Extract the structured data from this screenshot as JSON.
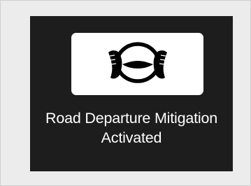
{
  "alert": {
    "icon": "road-departure-mitigation-icon",
    "line1": "Road Departure Mitigation",
    "line2": "Activated"
  },
  "colors": {
    "frame_background": "#ececec",
    "display_background": "#1d1d1d",
    "icon_background": "#ffffff",
    "text": "#ffffff"
  }
}
